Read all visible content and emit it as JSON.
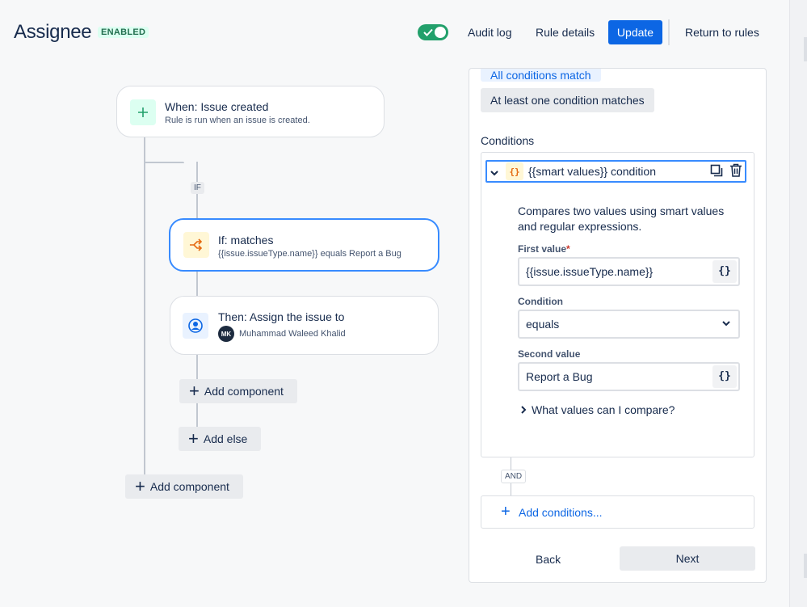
{
  "header": {
    "title": "Assignee",
    "status_badge": "ENABLED",
    "audit_log": "Audit log",
    "rule_details": "Rule details",
    "update": "Update",
    "return_to_rules": "Return to rules"
  },
  "flow": {
    "trigger": {
      "title": "When: Issue created",
      "subtitle": "Rule is run when an issue is created."
    },
    "if_tag": "IF",
    "condition": {
      "title": "If: matches",
      "subtitle": "{{issue.issueType.name}} equals Report a Bug"
    },
    "action": {
      "title": "Then: Assign the issue to",
      "avatar_initials": "MK",
      "assignee": "Muhammad Waleed Khalid"
    },
    "add_component_inner": "Add component",
    "add_else": "Add else",
    "add_component_outer": "Add component"
  },
  "panel": {
    "all_conditions": "All conditions match",
    "one_condition": "At least one condition matches",
    "conditions_title": "Conditions",
    "condition_card": {
      "icon_text": "{}",
      "label": "{{smart values}} condition",
      "description": "Compares two values using smart values and regular expressions.",
      "first_value_label": "First value",
      "required_mark": "*",
      "first_value": "{{issue.issueType.name}}",
      "condition_label": "Condition",
      "condition_value": "equals",
      "second_value_label": "Second value",
      "second_value": "Report a Bug",
      "brace_btn": "{}",
      "what_values": "What values can I compare?"
    },
    "and_tag": "AND",
    "add_conditions": "Add conditions...",
    "back": "Back",
    "next": "Next"
  },
  "colors": {
    "primary": "#0c66e4",
    "toggle_on": "#22a06b",
    "selected_border": "#388bff"
  }
}
